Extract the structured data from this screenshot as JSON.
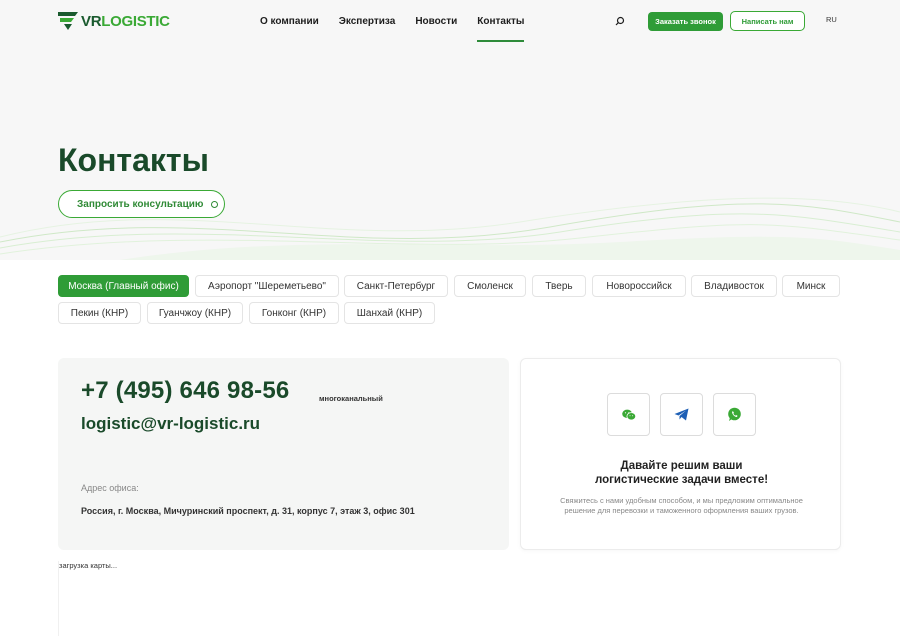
{
  "header": {
    "logo_vr": "VR",
    "logo_rest": "LOGISTIC",
    "nav": [
      {
        "label": "О компании",
        "active": false
      },
      {
        "label": "Экспертиза",
        "active": false
      },
      {
        "label": "Новости",
        "active": false
      },
      {
        "label": "Контакты",
        "active": true
      }
    ],
    "call_button": "Заказать звонок",
    "write_button": "Написать нам",
    "lang": "RU"
  },
  "hero": {
    "title": "Контакты",
    "consult_button": "Запросить консультацию"
  },
  "tabs": [
    "Москва (Главный офис)",
    "Аэропорт \"Шереметьево\"",
    "Санкт-Петербург",
    "Смоленск",
    "Тверь",
    "Новороссийск",
    "Владивосток",
    "Минск",
    "Пекин (КНР)",
    "Гуанчжоу (КНР)",
    "Гонконг (КНР)",
    "Шанхай (КНР)"
  ],
  "active_tab": "Москва (Главный офис)",
  "contact": {
    "phone": "+7 (495) 646 98-56",
    "phone_note": "многоканальный",
    "email": "logistic@vr-logistic.ru",
    "address_label": "Адрес офиса:",
    "address": "Россия, г. Москва, Мичуринский проспект, д. 31, корпус 7, этаж 3, офис 301"
  },
  "social": {
    "icons": [
      "wechat-icon",
      "telegram-icon",
      "whatsapp-icon"
    ],
    "title_line1": "Давайте решим ваши",
    "title_line2": "логистические задачи вместе!",
    "text_line1": "Свяжитесь с нами удобным способом, и мы предложим оптимальное",
    "text_line2": "решение для перевозки и таможенного оформления ваших грузов."
  },
  "map": {
    "loading_text": "загрузка карты..."
  },
  "colors": {
    "brand_green": "#2f9c37",
    "dark_green": "#1a4a2a",
    "whatsapp": "#3aa935",
    "telegram": "#1d5fb5"
  }
}
